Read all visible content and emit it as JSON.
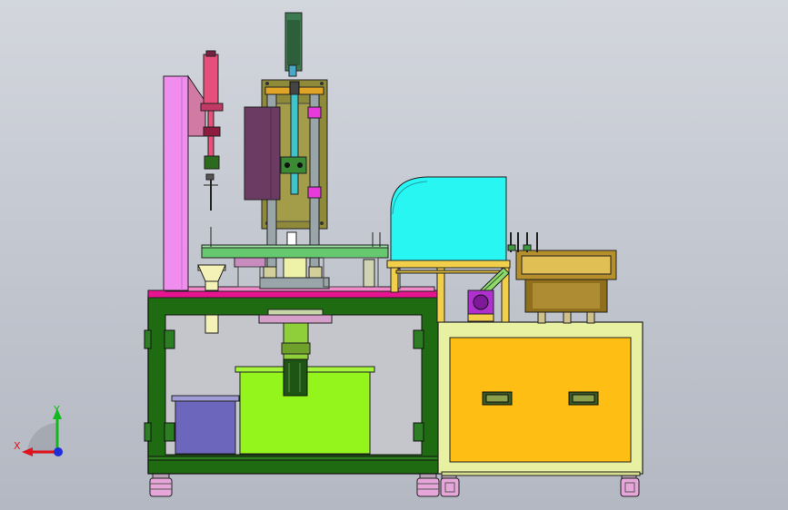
{
  "viewport": {
    "background_top": "#d3d6dd",
    "background_bottom": "#b3b8c2"
  },
  "triad": {
    "x_label": "X",
    "y_label": "Y",
    "x_color": "#e0141e",
    "y_color": "#12b81e",
    "z_color": "#1f2fd8"
  },
  "colors": {
    "frame_green": "#1f6b12",
    "frame_inner": "#c4c6cc",
    "pink_column": "#f28df0",
    "magenta_plate": "#e6148f",
    "cabinet_cream": "#e8f0a2",
    "drawer_orange": "#ffbe14",
    "hood_cyan": "#27f6f3",
    "bowl_brass": "#b58f2a",
    "purple_box": "#6c67bd",
    "lime_tank": "#93f51b",
    "olive_plate": "#8e8a39",
    "plum_panel": "#6b3b63",
    "caster_pink": "#e7a6d9"
  }
}
